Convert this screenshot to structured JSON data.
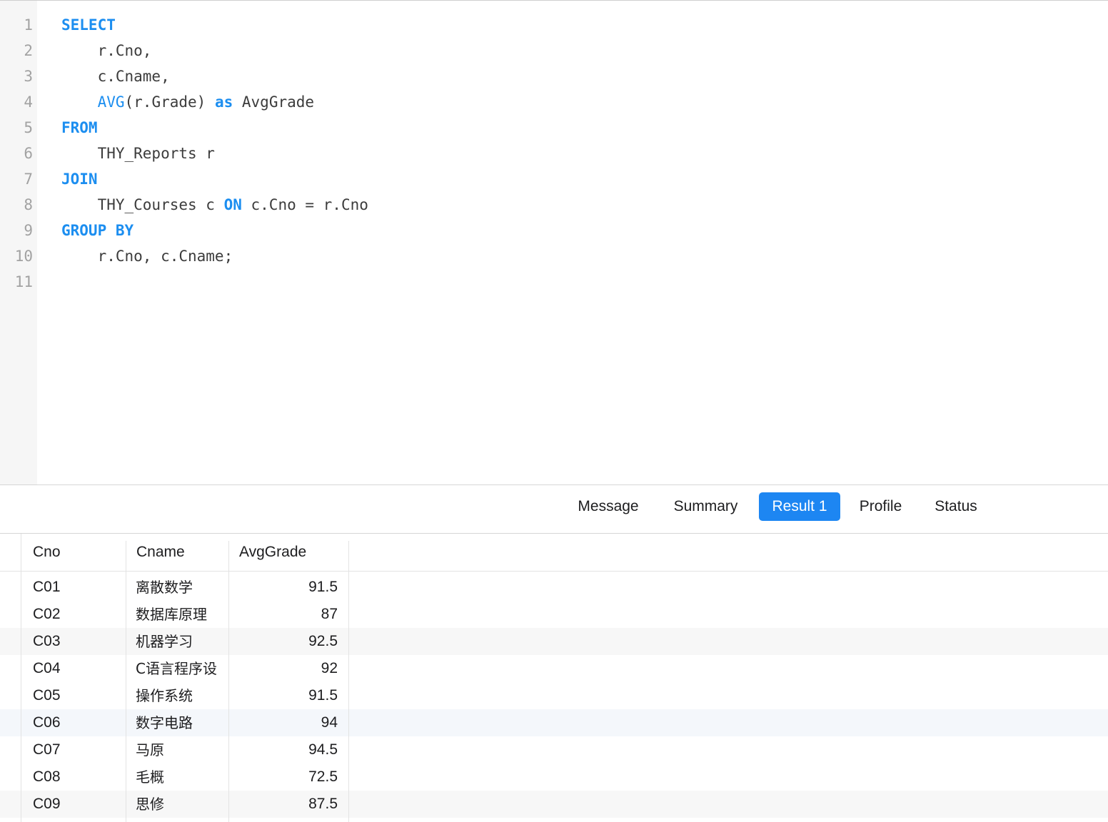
{
  "editor": {
    "line_numbers": [
      "1",
      "2",
      "3",
      "4",
      "5",
      "6",
      "7",
      "8",
      "9",
      "10",
      "11"
    ],
    "lines": [
      [
        {
          "t": "SELECT",
          "k": "kw"
        }
      ],
      [
        {
          "t": "    r.Cno,"
        }
      ],
      [
        {
          "t": "    c.Cname,"
        }
      ],
      [
        {
          "t": "    "
        },
        {
          "t": "AVG",
          "k": "fn"
        },
        {
          "t": "(r.Grade) "
        },
        {
          "t": "as",
          "k": "kw"
        },
        {
          "t": " AvgGrade"
        }
      ],
      [
        {
          "t": "FROM",
          "k": "kw"
        }
      ],
      [
        {
          "t": "    THY_Reports r"
        }
      ],
      [
        {
          "t": "JOIN",
          "k": "kw"
        }
      ],
      [
        {
          "t": "    THY_Courses c "
        },
        {
          "t": "ON",
          "k": "kw"
        },
        {
          "t": " c.Cno = r.Cno"
        }
      ],
      [
        {
          "t": "GROUP BY",
          "k": "kw"
        }
      ],
      [
        {
          "t": "    r.Cno, c.Cname;"
        }
      ],
      []
    ]
  },
  "tabs": {
    "message": "Message",
    "summary": "Summary",
    "result1": "Result 1",
    "profile": "Profile",
    "status": "Status",
    "active": "result1"
  },
  "result": {
    "columns": [
      "Cno",
      "Cname",
      "AvgGrade"
    ],
    "rows": [
      [
        "C01",
        "离散数学",
        "91.5"
      ],
      [
        "C02",
        "数据库原理",
        "87"
      ],
      [
        "C03",
        "机器学习",
        "92.5"
      ],
      [
        "C04",
        "C语言程序设",
        "92"
      ],
      [
        "C05",
        "操作系统",
        "91.5"
      ],
      [
        "C06",
        "数字电路",
        "94"
      ],
      [
        "C07",
        "马原",
        "94.5"
      ],
      [
        "C08",
        "毛概",
        "72.5"
      ],
      [
        "C09",
        "思修",
        "87.5"
      ]
    ]
  },
  "colors": {
    "keyword": "#1c8ef0",
    "active_tab": "#1d86f2"
  }
}
